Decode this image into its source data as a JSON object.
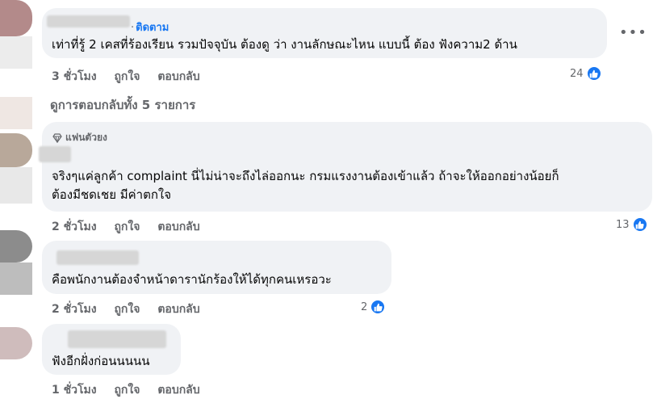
{
  "comments": [
    {
      "follow_label": "ติดตาม",
      "text": [
        "เท่าที่รู้ 2 เคสที่ร้องเรียน รวมปัจจุบัน ต้องดู ว่า งานลักษณะไหน แบบนี้ ต้อง ฟังความ2 ด้าน"
      ],
      "time": "3 ชั่วโมง",
      "like": "ถูกใจ",
      "reply": "ตอบกลับ",
      "reactions": "24",
      "colors": {
        "avatar": "#b38a8a"
      }
    },
    {
      "badge": "แฟนตัวยง",
      "text": [
        "จริงๆแค่ลูกค้า complaint นี่ไม่น่าจะถึงไล่ออกนะ กรมแรงงานต้องเข้าแล้ว ถ้าจะให้ออกอย่างน้อยก็",
        "ต้องมีชดเชย มีค่าตกใจ"
      ],
      "time": "2 ชั่วโมง",
      "like": "ถูกใจ",
      "reply": "ตอบกลับ",
      "reactions": "13",
      "colors": {
        "avatar": "#b8a89a"
      }
    },
    {
      "text": [
        "คือพนักงานต้องจำหน้าดารานักร้องให้ได้ทุกคนเหรอวะ"
      ],
      "time": "2 ชั่วโมง",
      "like": "ถูกใจ",
      "reply": "ตอบกลับ",
      "reactions": "2",
      "colors": {
        "avatar": "#8c8c8c"
      }
    },
    {
      "text": [
        "ฟังอีกฝั่งก่อนนนนน"
      ],
      "time": "1 ชั่วโมง",
      "like": "ถูกใจ",
      "reply": "ตอบกลับ",
      "colors": {
        "avatar": "#cfbcbc"
      }
    }
  ],
  "view_replies": "ดูการตอบกลับทั้ง 5 รายการ",
  "more_icon": "more-options-icon",
  "like_icon": "thumbs-up-icon",
  "badge_icon": "diamond-icon",
  "accent": "#1877f2",
  "bubble_bg": "#f0f2f5",
  "muted": "#65676b"
}
